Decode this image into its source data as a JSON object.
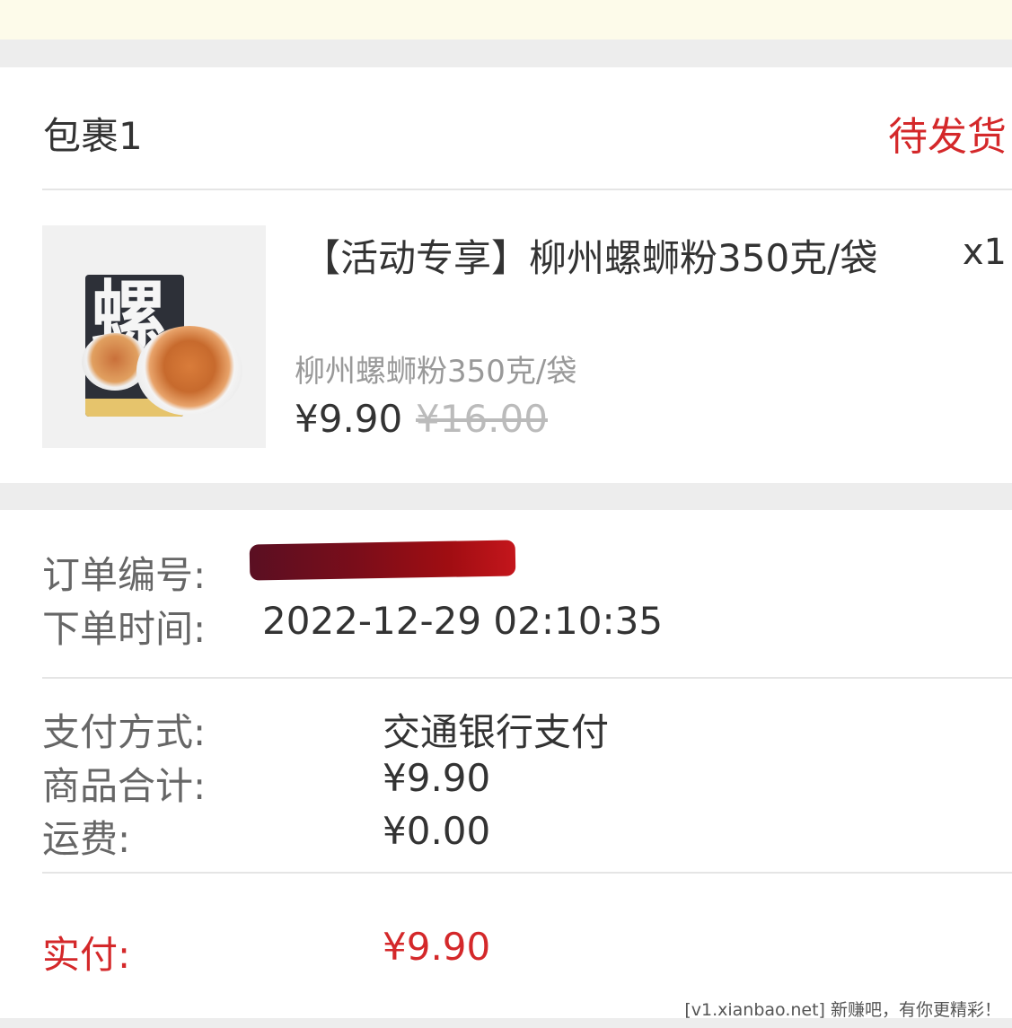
{
  "package": {
    "title": "包裹1",
    "status": "待发货"
  },
  "product": {
    "title": "【活动专享】柳州螺蛳粉350克/袋",
    "quantity": "x1",
    "spec": "柳州螺蛳粉350克/袋",
    "price": "¥9.90",
    "original_price": "¥16.00",
    "image_text": "螺",
    "image_icon": "noodle-product-image"
  },
  "order": {
    "order_no_label": "订单编号:",
    "order_time_label": "下单时间:",
    "order_time": "2022-12-29 02:10:35",
    "payment_method_label": "支付方式:",
    "payment_method": "交通银行支付",
    "subtotal_label": "商品合计:",
    "subtotal": "¥9.90",
    "shipping_label": "运费:",
    "shipping": "¥0.00",
    "paid_label": "实付:",
    "paid": "¥9.90"
  },
  "watermark": "[v1.xianbao.net] 新赚吧，有你更精彩！",
  "colors": {
    "accent_red": "#d4282a",
    "topbar": "#fdfbea",
    "background": "#ededed"
  }
}
